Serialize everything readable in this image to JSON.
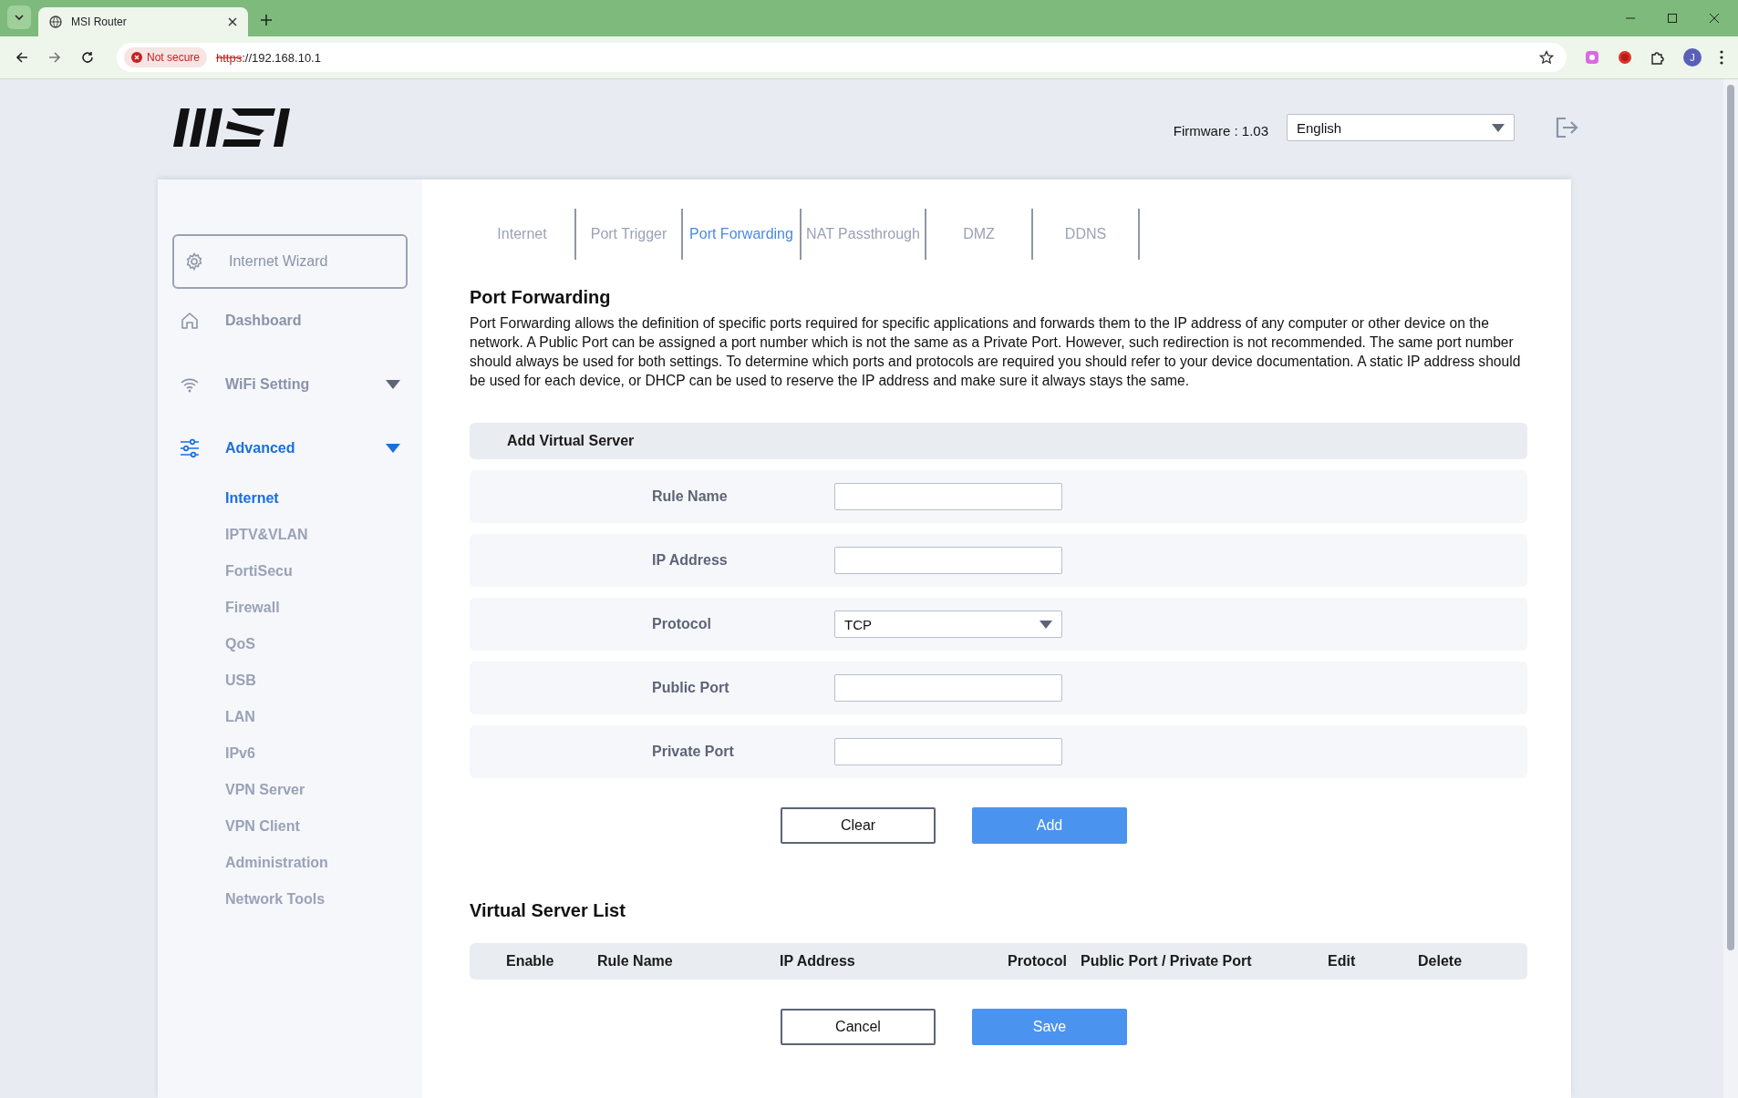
{
  "browser": {
    "tab_title": "MSI Router",
    "security_label": "Not secure",
    "url_scheme": "https",
    "url_rest": "://192.168.10.1",
    "profile_letter": "J"
  },
  "header": {
    "firmware": "Firmware : 1.03",
    "language": "English"
  },
  "sidebar": {
    "wizard": "Internet Wizard",
    "items": [
      {
        "kind": "link",
        "label": "Dashboard",
        "selected": false
      },
      {
        "kind": "group",
        "label": "WiFi Setting",
        "selected": false,
        "expanded": false
      },
      {
        "kind": "group",
        "label": "Advanced",
        "selected": true,
        "expanded": true,
        "children": [
          {
            "label": "Internet",
            "selected": true
          },
          {
            "label": "IPTV&VLAN",
            "selected": false
          },
          {
            "label": "FortiSecu",
            "selected": false
          },
          {
            "label": "Firewall",
            "selected": false
          },
          {
            "label": "QoS",
            "selected": false
          },
          {
            "label": "USB",
            "selected": false
          },
          {
            "label": "LAN",
            "selected": false
          },
          {
            "label": "IPv6",
            "selected": false
          },
          {
            "label": "VPN Server",
            "selected": false
          },
          {
            "label": "VPN Client",
            "selected": false
          },
          {
            "label": "Administration",
            "selected": false
          },
          {
            "label": "Network Tools",
            "selected": false
          }
        ]
      }
    ]
  },
  "tabs": [
    {
      "label": "Internet",
      "selected": false
    },
    {
      "label": "Port Trigger",
      "selected": false
    },
    {
      "label": "Port Forwarding",
      "selected": true
    },
    {
      "label": "NAT Passthrough",
      "selected": false
    },
    {
      "label": "DMZ",
      "selected": false
    },
    {
      "label": "DDNS",
      "selected": false
    }
  ],
  "section": {
    "title": "Port Forwarding",
    "description": "Port Forwarding allows the definition of specific ports required for specific applications and forwards them to the IP address of any computer or other device on the network. A Public Port can be assigned a port number which is not the same as a Private Port. However, such redirection is not recommended. The same port number should always be used for both settings. To determine which ports and protocols are required you should refer to your device documentation. A static IP address should be used for each device, or DHCP can be used to reserve the IP address and make sure it always stays the same."
  },
  "form": {
    "header": "Add Virtual Server",
    "fields": [
      {
        "kind": "text",
        "label": "Rule Name"
      },
      {
        "kind": "text",
        "label": "IP Address"
      },
      {
        "kind": "select",
        "label": "Protocol",
        "value": "TCP"
      },
      {
        "kind": "text",
        "label": "Public Port"
      },
      {
        "kind": "text",
        "label": "Private Port"
      }
    ],
    "buttons": [
      {
        "kind": "secondary",
        "label": "Clear"
      },
      {
        "kind": "primary",
        "label": "Add"
      }
    ]
  },
  "list": {
    "title": "Virtual Server List",
    "columns": [
      "Enable",
      "Rule Name",
      "IP Address",
      "Protocol",
      "Public Port / Private Port",
      "Edit",
      "Delete"
    ],
    "buttons": [
      {
        "kind": "secondary",
        "label": "Cancel"
      },
      {
        "kind": "primary",
        "label": "Save"
      }
    ]
  }
}
